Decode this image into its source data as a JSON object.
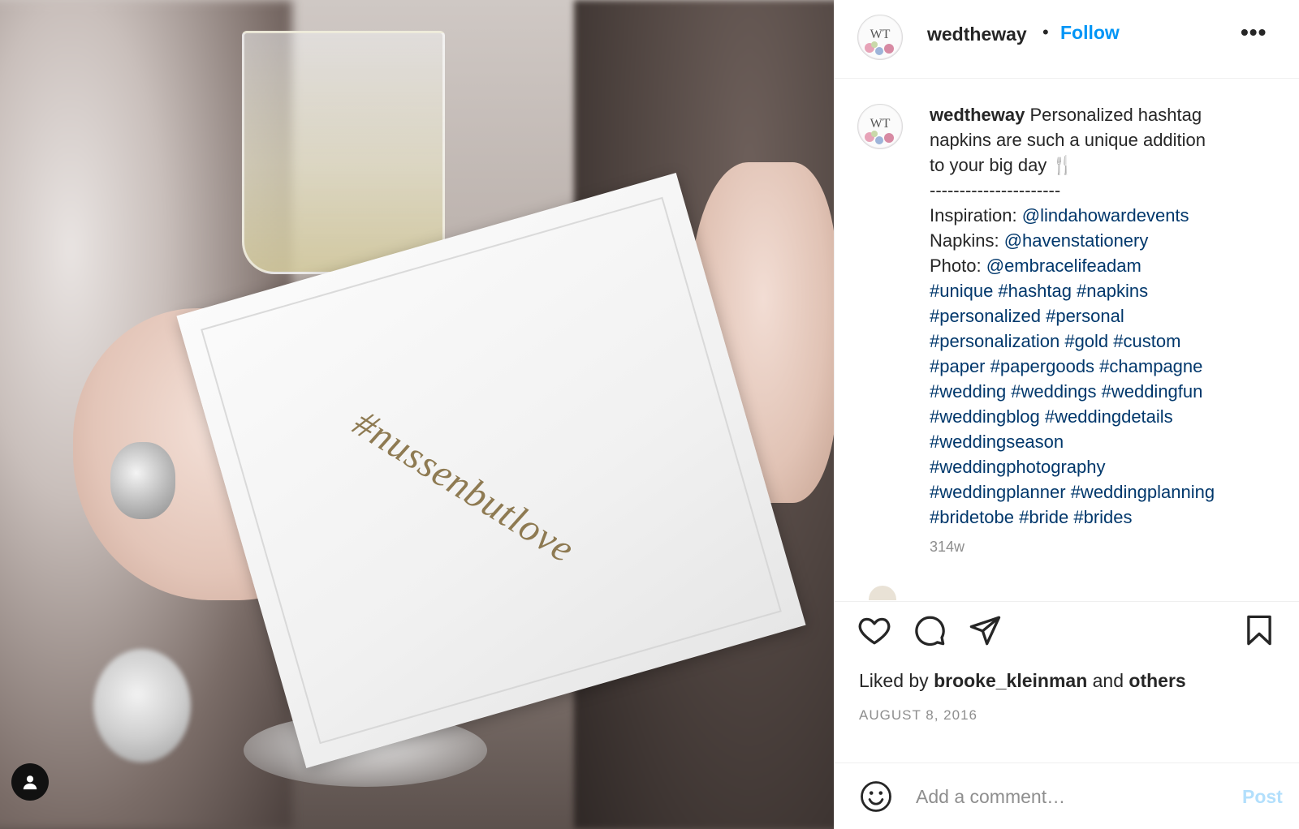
{
  "photo": {
    "napkin_text": "#nussenbutlove",
    "user_tag_icon": "person-icon"
  },
  "header": {
    "avatar_icon": "wedtheway-logo",
    "username": "wedtheway",
    "separator": "•",
    "follow_label": "Follow",
    "more_label": "•••"
  },
  "caption": {
    "username": "wedtheway",
    "text_line1": "Personalized hashtag",
    "text_line2": "napkins are such a unique addition",
    "text_line3": "to your big day 🍴",
    "divider": "----------------------",
    "credits": [
      {
        "label": "Inspiration:",
        "handle": "@lindahowardevents"
      },
      {
        "label": "Napkins:",
        "handle": "@havenstationery"
      },
      {
        "label": "Photo:",
        "handle": "@embracelifeadam"
      }
    ],
    "hashtag_lines": [
      "#unique #hashtag #napkins",
      "#personalized #personal",
      "#personalization #gold #custom",
      "#paper #papergoods #champagne",
      "#wedding #weddings #weddingfun",
      "#weddingblog #weddingdetails",
      "#weddingseason",
      "#weddingphotography",
      "#weddingplanner #weddingplanning",
      "#bridetobe #bride #brides"
    ],
    "age": "314w"
  },
  "actions": {
    "like_icon": "heart-icon",
    "comment_icon": "comment-icon",
    "share_icon": "paper-plane-icon",
    "save_icon": "bookmark-icon",
    "liked_prefix": "Liked by",
    "liked_user": "brooke_kleinman",
    "liked_and": "and",
    "liked_others": "others",
    "date": "AUGUST 8, 2016"
  },
  "add_comment": {
    "emoji_icon": "smiley-icon",
    "placeholder": "Add a comment…",
    "post_label": "Post"
  },
  "colors": {
    "accent": "#0095f6",
    "link": "#00376b",
    "muted": "#8e8e8e",
    "post_disabled": "#b2dffc"
  }
}
